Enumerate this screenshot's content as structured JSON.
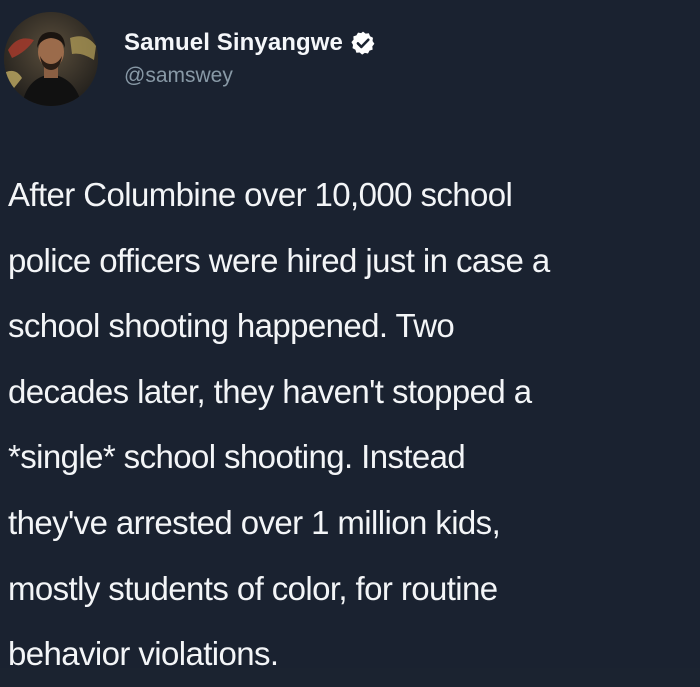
{
  "user": {
    "display_name": "Samuel Sinyangwe",
    "handle": "@samswey",
    "verified": true,
    "avatar_icon": "profile-photo"
  },
  "tweet": {
    "lines": [
      "After Columbine over 10,000 school",
      "police officers were hired just in case a",
      "school shooting happened. Two",
      "decades later, they haven't stopped a",
      "*single* school shooting. Instead",
      "they've arrested over 1 million kids,",
      "mostly students of color, for routine",
      "behavior violations."
    ]
  },
  "colors": {
    "background": "#1a2230",
    "text": "#f3f5f7",
    "handle": "#8899a6",
    "verified_badge": "#ffffff"
  }
}
